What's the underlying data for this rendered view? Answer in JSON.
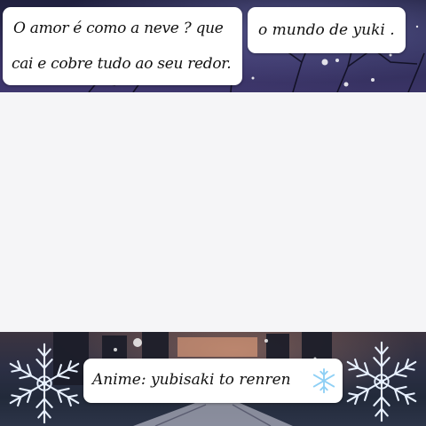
{
  "quote": {
    "line1": "O amor é como a neve ? que",
    "line2": "cai e cobre tudo ao seu redor."
  },
  "tag": "o mundo de yuki .",
  "credit": "Anime: yubisaki to renren",
  "icons": [
    "snowflake-icon"
  ],
  "colors": {
    "bubble": "#ffffff",
    "night_sky": "#2b2a52",
    "snowflake": "#bfe3ff"
  }
}
